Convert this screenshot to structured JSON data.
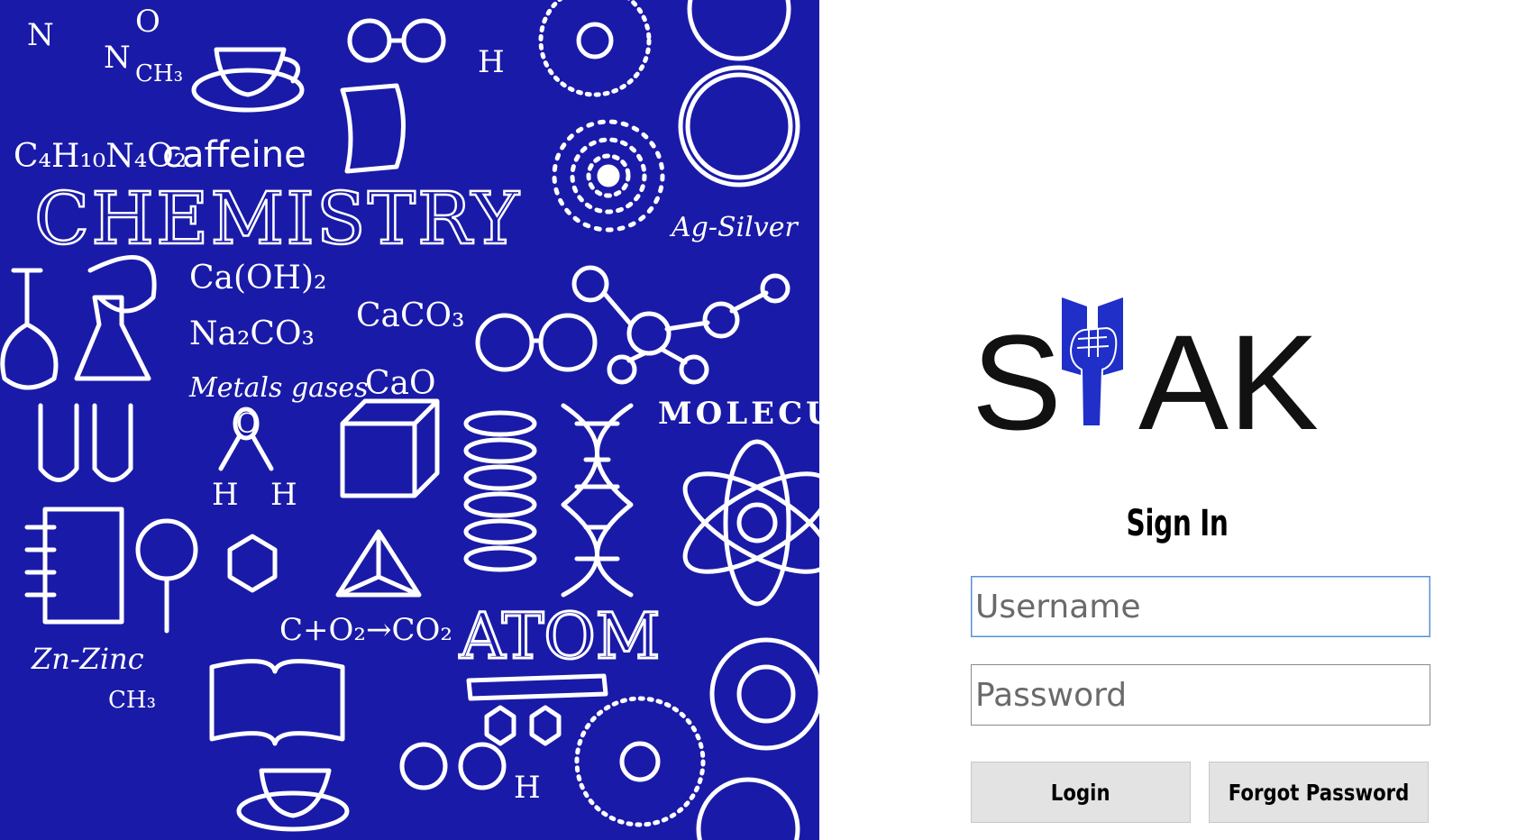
{
  "art": {
    "texts": [
      "C₄H₁₀N₄O₂",
      "caffeine",
      "CHEMISTRY",
      "Ag-Silver",
      "Ca(OH)₂",
      "Na₂CO₃",
      "CaCO₃",
      "CaO",
      "Metals gases",
      "MOLECUL",
      "H",
      "H",
      "O",
      "H",
      "C+O₂→CO₂",
      "Zn-Zinc",
      "ATOM",
      "CH₃",
      "CH₃",
      "N",
      "O",
      "N",
      "H"
    ]
  },
  "logo": {
    "left": "S",
    "right": "AK"
  },
  "signin": {
    "title": "Sign In",
    "username_placeholder": "Username",
    "password_placeholder": "Password",
    "login_label": "Login",
    "forgot_label": "Forgot Password"
  },
  "colors": {
    "art_background": "#1a1aa8",
    "logo_accent": "#1f2fc8",
    "button_bg": "#e3e3e3"
  }
}
